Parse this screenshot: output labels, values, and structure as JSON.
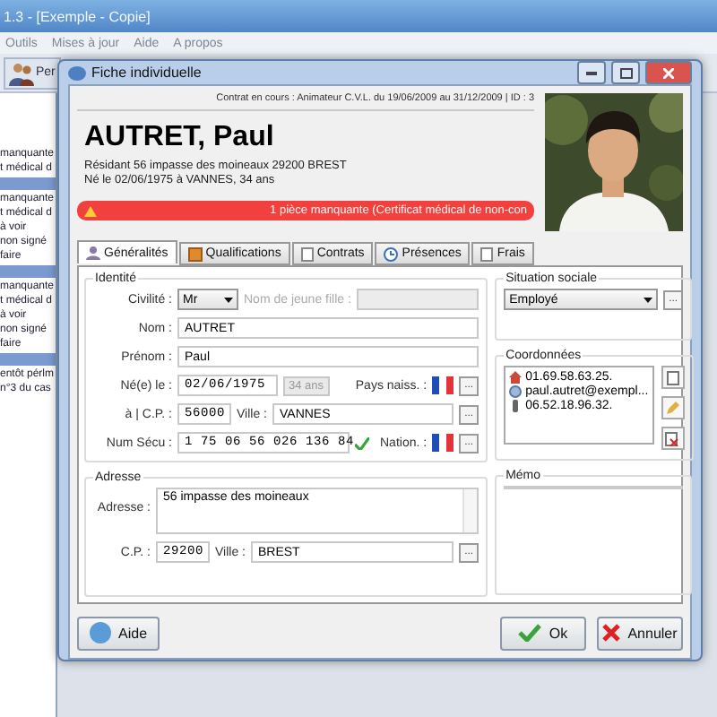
{
  "app": {
    "title": "1.3 - [Exemple - Copie]",
    "menu": [
      "Outils",
      "Mises à jour",
      "Aide",
      "A propos"
    ],
    "toolbar_label": "Per",
    "sidebar": [
      {
        "kind": "item",
        "text": "manquante"
      },
      {
        "kind": "item",
        "text": "t médical d"
      },
      {
        "kind": "header"
      },
      {
        "kind": "item",
        "text": "manquante"
      },
      {
        "kind": "item",
        "text": "t médical d"
      },
      {
        "kind": "item",
        "text": "à voir"
      },
      {
        "kind": "item",
        "text": "non signé"
      },
      {
        "kind": "item",
        "text": "faire"
      },
      {
        "kind": "header"
      },
      {
        "kind": "item",
        "text": "manquante"
      },
      {
        "kind": "item",
        "text": "t médical d"
      },
      {
        "kind": "item",
        "text": "à voir"
      },
      {
        "kind": "item",
        "text": "non signé"
      },
      {
        "kind": "item",
        "text": "faire"
      },
      {
        "kind": "header"
      },
      {
        "kind": "item",
        "text": "entôt pérlm"
      },
      {
        "kind": "item",
        "text": "n°3 du cas"
      }
    ]
  },
  "dialog": {
    "title": "Fiche individuelle",
    "contract": "Contrat en cours : Animateur C.V.L. du 19/06/2009 au 31/12/2009 | ID : 3",
    "name": "AUTRET, Paul",
    "resident": "Résidant 56 impasse des moineaux 29200 BREST",
    "born": "Né le 02/06/1975 à VANNES, 34 ans",
    "alert": "1 pièce manquante (Certificat médical de non-con",
    "tabs": [
      {
        "label": "Généralités",
        "selected": true
      },
      {
        "label": "Qualifications",
        "selected": false
      },
      {
        "label": "Contrats",
        "selected": false
      },
      {
        "label": "Présences",
        "selected": false
      },
      {
        "label": "Frais",
        "selected": false
      }
    ],
    "identity": {
      "title": "Identité",
      "civilite": {
        "label": "Civilité :",
        "value": "Mr"
      },
      "maiden": {
        "label": "Nom de jeune fille :",
        "disabled": true
      },
      "nom": {
        "label": "Nom :",
        "value": "AUTRET"
      },
      "prenom": {
        "label": "Prénom :",
        "value": "Paul"
      },
      "birth": {
        "label": "Né(e) le :",
        "value": "02/06/1975",
        "age": "34 ans"
      },
      "birth_country": {
        "label": "Pays naiss. :",
        "browse": "..."
      },
      "place": {
        "label": "à | C.P. :",
        "value": "56000",
        "city_label": "Ville :",
        "city": "VANNES",
        "browse": "..."
      },
      "secu": {
        "label": "Num Sécu :",
        "value": "1 75 06 56 026 136 84",
        "valid": true
      },
      "nationality": {
        "label": "Nation. :",
        "browse": "..."
      }
    },
    "address": {
      "title": "Adresse",
      "label": "Adresse :",
      "value": "56 impasse des moineaux",
      "cp_label": "C.P. :",
      "cp": "29200",
      "city_label": "Ville :",
      "city": "BREST",
      "browse": "..."
    },
    "social": {
      "title": "Situation sociale",
      "value": "Employé",
      "browse": "..."
    },
    "contacts": {
      "title": "Coordonnées",
      "items": [
        {
          "kind": "phone",
          "text": "01.69.58.63.25."
        },
        {
          "kind": "email",
          "text": "paul.autret@exempl..."
        },
        {
          "kind": "mobile",
          "text": "06.52.18.96.32."
        }
      ]
    },
    "memo": {
      "title": "Mémo"
    },
    "buttons": {
      "help": "Aide",
      "ok": "Ok",
      "cancel": "Annuler"
    }
  }
}
